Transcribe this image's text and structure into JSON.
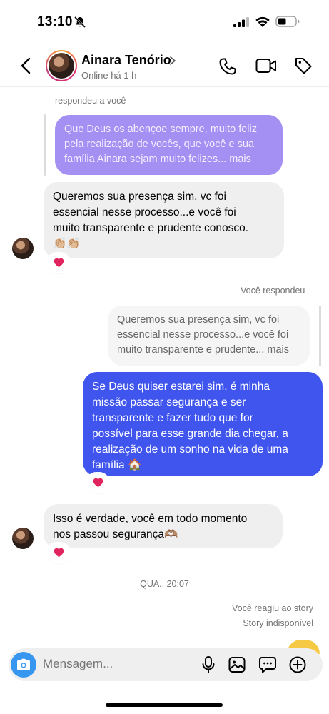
{
  "status_bar": {
    "time": "13:10"
  },
  "header": {
    "contact_name": "Ainara Tenório",
    "contact_status": "Online há 1 h"
  },
  "messages": {
    "reply_label_1": "respondeu a você",
    "quoted_1": [
      "Que Deus os abençoe sempre, muito feliz",
      "pela realização de vocês, que você e sua",
      "família  Ainara sejam muito felizes... mais"
    ],
    "incoming_1": [
      "Queremos sua presença sim, vc foi",
      "essencial nesse processo...e você foi",
      "muito transparente e prudente conosco.",
      "👏🏼👏🏼"
    ],
    "reply_label_2": "Você respondeu",
    "quoted_2": [
      "Queremos sua presença sim, vc foi",
      "essencial nesse processo...e você foi",
      "muito transparente e prudente... mais"
    ],
    "outgoing_1": [
      "Se Deus quiser estarei sim, é minha",
      "missão passar segurança e ser",
      "transparente e fazer tudo que for",
      "possível para esse grande dia chegar, a",
      "realização de um sonho na vida de uma",
      "família 🏠"
    ],
    "incoming_2": [
      "Isso é verdade, você em todo momento",
      "nos passou segurança🫶🏽"
    ],
    "timestamp": "QUA., 20:07",
    "story_reaction": "Você reagiu ao story",
    "story_unavailable": "Story indisponível"
  },
  "composer": {
    "placeholder": "Mensagem..."
  },
  "colors": {
    "outgoing_bubble": "#3f55ee",
    "quoted_bubble": "#a48ff3",
    "incoming_bubble": "#efefef",
    "reaction": "#e0245e"
  }
}
